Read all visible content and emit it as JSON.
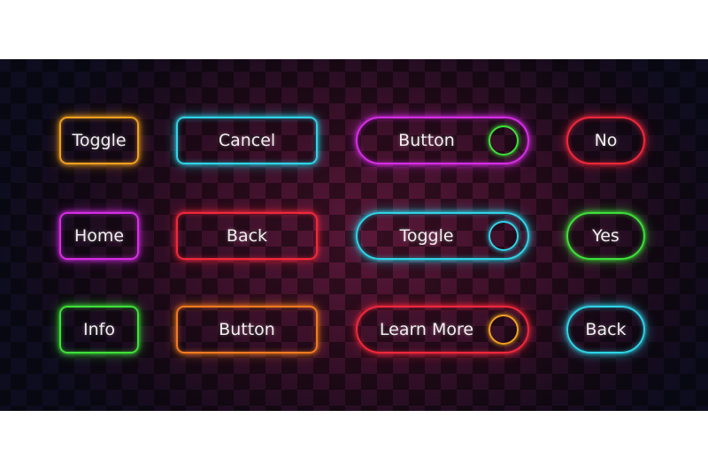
{
  "buttons": [
    {
      "label": "Toggle",
      "color": "#f0a020"
    },
    {
      "label": "Cancel",
      "color": "#2fd3e6"
    },
    {
      "label": "Button",
      "color": "#d62de6",
      "knob_color": "#3fe03a",
      "knob_icon": "circle-icon"
    },
    {
      "label": "No",
      "color": "#f0283c"
    },
    {
      "label": "Home",
      "color": "#d62de6"
    },
    {
      "label": "Back",
      "color": "#f0283c"
    },
    {
      "label": "Toggle",
      "color": "#2fd3e6",
      "knob_color": "#2fd3e6",
      "knob_icon": "circle-icon"
    },
    {
      "label": "Yes",
      "color": "#3fe03a"
    },
    {
      "label": "Info",
      "color": "#3fe03a"
    },
    {
      "label": "Button",
      "color": "#f07a20"
    },
    {
      "label": "Learn More",
      "color": "#f0283c",
      "knob_color": "#f0a020",
      "knob_icon": "circle-icon"
    },
    {
      "label": "Back",
      "color": "#2fd3e6"
    }
  ]
}
